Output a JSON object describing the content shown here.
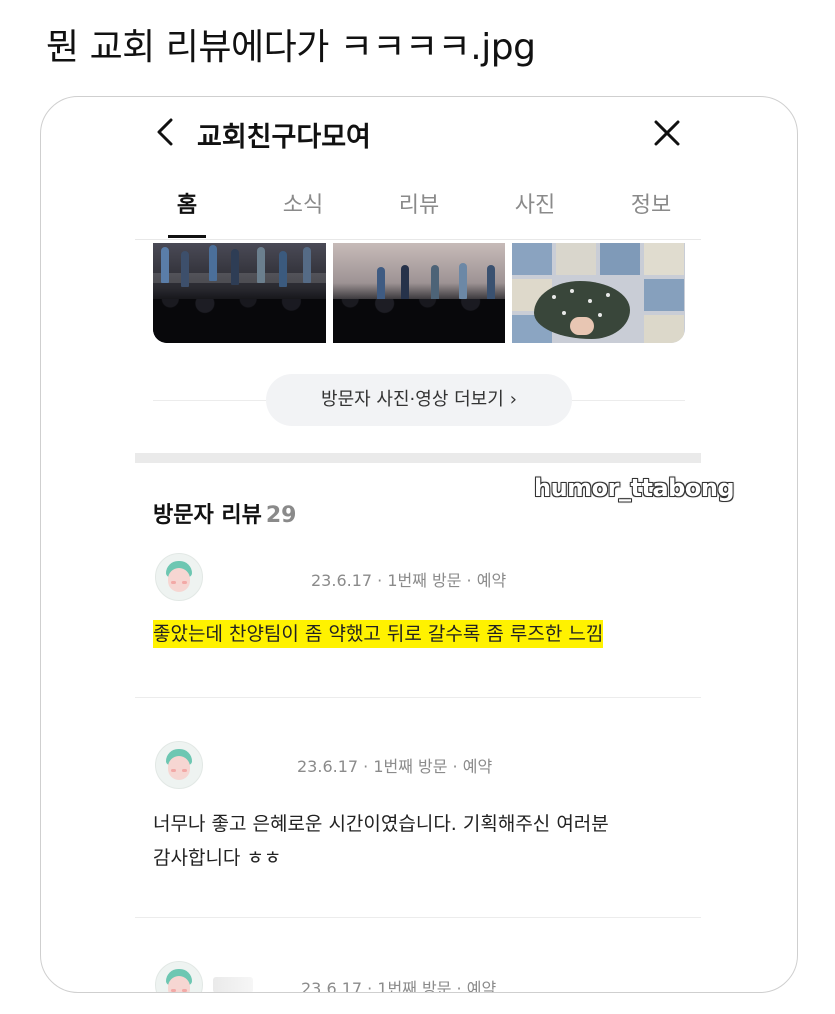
{
  "post": {
    "title": "뭔 교회 리뷰에다가 ㅋㅋㅋㅋ.jpg"
  },
  "header": {
    "place_name": "교회친구다모여",
    "back_icon": "chevron-left-icon",
    "close_icon": "close-icon"
  },
  "tabs": [
    {
      "label": "홈",
      "active": true
    },
    {
      "label": "소식",
      "active": false
    },
    {
      "label": "리뷰",
      "active": false
    },
    {
      "label": "사진",
      "active": false
    },
    {
      "label": "정보",
      "active": false
    }
  ],
  "photos": {
    "more_label": "방문자 사진·영상 더보기",
    "more_chevron": "›"
  },
  "watermark": "humor_ttabong",
  "reviews_section": {
    "title": "방문자 리뷰",
    "count": "29"
  },
  "reviews": [
    {
      "meta": "23.6.17 · 1번째 방문 · 예약",
      "text": "좋았는데 찬양팀이 좀 약했고 뒤로 갈수록 좀 루즈한 느낌",
      "highlighted": true
    },
    {
      "meta": "23.6.17 · 1번째 방문 · 예약",
      "text_line1": "너무나 좋고 은혜로운 시간이였습니다. 기획해주신 여러분",
      "text_line2": "감사합니다 ㅎㅎ",
      "highlighted": false
    },
    {
      "meta": "23.6.17 · 1번째 방문 · 예약"
    }
  ],
  "colors": {
    "highlight": "#fff200",
    "avatar_hair": "#6dc7b2",
    "muted_text": "#8b8b8b"
  }
}
